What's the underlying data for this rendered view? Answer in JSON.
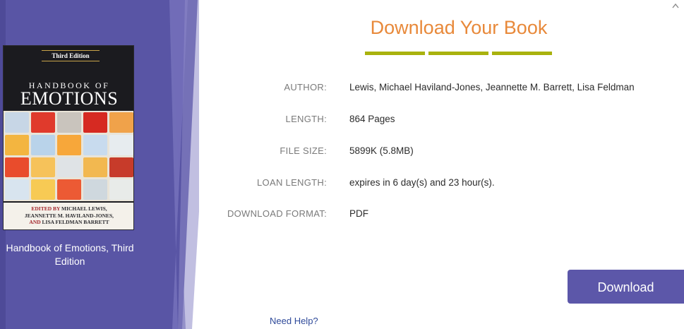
{
  "header": {
    "title": "Download Your Book"
  },
  "book": {
    "cover": {
      "edition": "Third Edition",
      "title_top": "HANDBOOK OF",
      "title_main": "EMOTIONS",
      "credits_line1_prefix": "EDITED BY",
      "credits_line1": "MICHAEL LEWIS,",
      "credits_line2": "JEANNETTE M. HAVILAND-JONES,",
      "credits_line3_prefix": "AND",
      "credits_line3": "LISA FELDMAN BARRETT"
    },
    "caption": "Handbook of Emotions, Third Edition"
  },
  "details": [
    {
      "label": "AUTHOR:",
      "value": "Lewis, Michael Haviland-Jones, Jeannette M. Barrett, Lisa Feldman"
    },
    {
      "label": "LENGTH:",
      "value": "864 Pages"
    },
    {
      "label": "FILE SIZE:",
      "value": "5899K (5.8MB)"
    },
    {
      "label": "LOAN LENGTH:",
      "value": "expires in 6 day(s) and 23 hour(s)."
    },
    {
      "label": "DOWNLOAD FORMAT:",
      "value": "PDF"
    }
  ],
  "actions": {
    "download_label": "Download",
    "help_label": "Need Help?"
  },
  "icons": {
    "collapse": "chevron-up-icon"
  },
  "colors": {
    "panel": "#5753a3",
    "heading": "#e8893a",
    "underline": "#a9b20e",
    "button": "#5c57a9",
    "link": "#2f4a9a"
  }
}
